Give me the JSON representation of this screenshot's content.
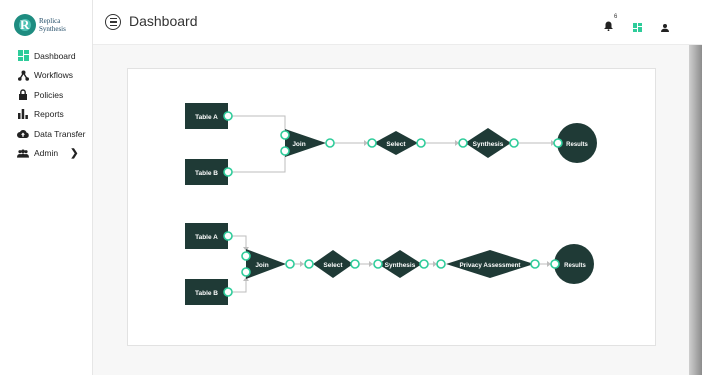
{
  "brand": {
    "line1": "Replica",
    "line2": "Synthesis",
    "mark": "R"
  },
  "sidebar": {
    "items": [
      {
        "label": "Dashboard",
        "icon": "dashboard-icon"
      },
      {
        "label": "Workflows",
        "icon": "workflow-icon"
      },
      {
        "label": "Policies",
        "icon": "lock-icon"
      },
      {
        "label": "Reports",
        "icon": "bar-chart-icon"
      },
      {
        "label": "Data Transfer",
        "icon": "cloud-upload-icon"
      },
      {
        "label": "Admin",
        "icon": "group-icon"
      }
    ]
  },
  "header": {
    "title": "Dashboard",
    "notification_count": "6"
  },
  "colors": {
    "accent": "#2ecc9a",
    "node_dark": "#1f3a36",
    "brand_teal": "#1e8c80"
  },
  "workflow1": {
    "table_a": "Table A",
    "table_b": "Table B",
    "join": "Join",
    "select": "Select",
    "synthesis": "Synthesis",
    "results": "Results"
  },
  "workflow2": {
    "table_a": "Table A",
    "table_b": "Table B",
    "join": "Join",
    "select": "Select",
    "synthesis": "Synthesis",
    "privacy": "Privacy Assessment",
    "results": "Results"
  }
}
